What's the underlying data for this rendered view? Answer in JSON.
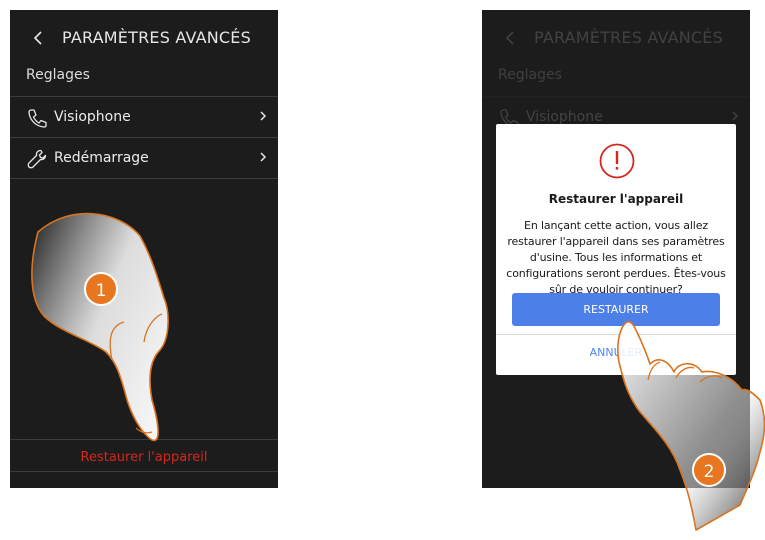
{
  "left_screen": {
    "header": {
      "title": "PARAMÈTRES AVANCÉS",
      "back_icon": "chevron-left-icon"
    },
    "section_label": "Reglages",
    "menu": [
      {
        "label": "Visiophone",
        "icon": "phone-icon"
      },
      {
        "label": "Redémarrage",
        "icon": "wrench-icon"
      }
    ],
    "restore_link": "Restaurer l'appareil"
  },
  "right_screen": {
    "header": {
      "title": "PARAMÈTRES AVANCÉS"
    },
    "section_label": "Reglages",
    "menu": [
      {
        "label": "Visiophone",
        "icon": "phone-icon"
      }
    ],
    "dialog": {
      "icon": "warning-icon",
      "title": "Restaurer l'appareil",
      "message": "En lançant cette action, vous allez restaurer l'appareil dans ses paramètres d'usine. Tous les informations et configurations seront perdues. Êtes-vous sûr de vouloir continuer?",
      "confirm_label": "RESTAURER",
      "cancel_label": "ANNULER"
    }
  },
  "step_badges": [
    "1",
    "2"
  ],
  "colors": {
    "screen_bg": "#1c1c1c",
    "accent_red": "#d4271e",
    "button_blue": "#4d7fe8",
    "badge_orange": "#e8761e",
    "hand_outline": "#d9731e"
  }
}
